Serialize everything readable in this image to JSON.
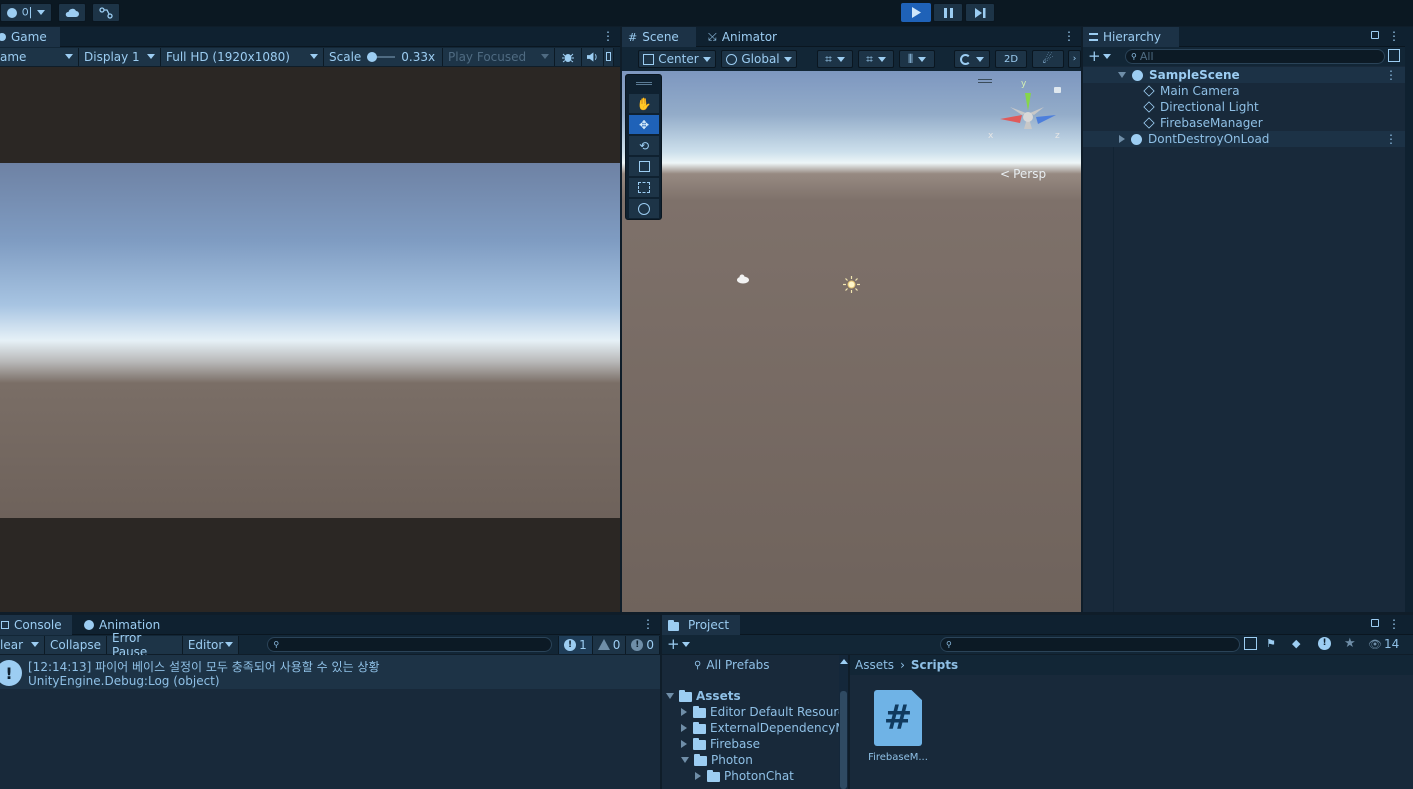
{
  "topbar": {
    "account_label": "이",
    "play_tooltip": "play-icon",
    "pause_tooltip": "pause-icon",
    "step_tooltip": "step-icon"
  },
  "game": {
    "tab_label": "Game",
    "mode_dropdown": "ame",
    "display_dropdown": "Display 1",
    "resolution_dropdown": "Full HD (1920x1080)",
    "scale_label": "Scale",
    "scale_value": "0.33x",
    "scale_level": 0.05,
    "play_focused": "Play Focused"
  },
  "scene": {
    "tab_scene": "Scene",
    "tab_animator": "Animator",
    "pivot_dropdown": "Center",
    "space_dropdown": "Global",
    "mode_2d": "2D",
    "persp_label": "Persp",
    "gizmo_y": "y",
    "gizmo_x": "x",
    "gizmo_z": "z"
  },
  "hierarchy": {
    "tab_label": "Hierarchy",
    "search_placeholder": "All",
    "items": [
      {
        "label": "SampleScene"
      },
      {
        "label": "Main Camera"
      },
      {
        "label": "Directional Light"
      },
      {
        "label": "FirebaseManager"
      },
      {
        "label": "DontDestroyOnLoad"
      }
    ]
  },
  "console": {
    "tab_console": "Console",
    "tab_animation": "Animation",
    "clear_label": "lear",
    "collapse_label": "Collapse",
    "error_pause_label": "Error Pause",
    "editor_dropdown": "Editor",
    "count_info": "1",
    "count_warn": "0",
    "count_error": "0",
    "log_line1": "[12:14:13] 파이어 베이스 설정이 모두 충족되어 사용할 수 있는 상황",
    "log_line2": "UnityEngine.Debug:Log (object)"
  },
  "project": {
    "tab_label": "Project",
    "hidden_count": "14",
    "tree": [
      {
        "label": "All Prefabs"
      },
      {
        "label": "Assets"
      },
      {
        "label": "Editor Default Resourc"
      },
      {
        "label": "ExternalDependencyM"
      },
      {
        "label": "Firebase"
      },
      {
        "label": "Photon"
      },
      {
        "label": "PhotonChat"
      }
    ],
    "breadcrumb_root": "Assets",
    "breadcrumb_current": "Scripts",
    "file_label": "FirebaseM...",
    "file_glyph": "#"
  },
  "colors": {
    "accent": "#1f62b8",
    "panel_bg": "#18293a",
    "text": "#8fc0e6",
    "script_icon": "#6fb3e6"
  }
}
